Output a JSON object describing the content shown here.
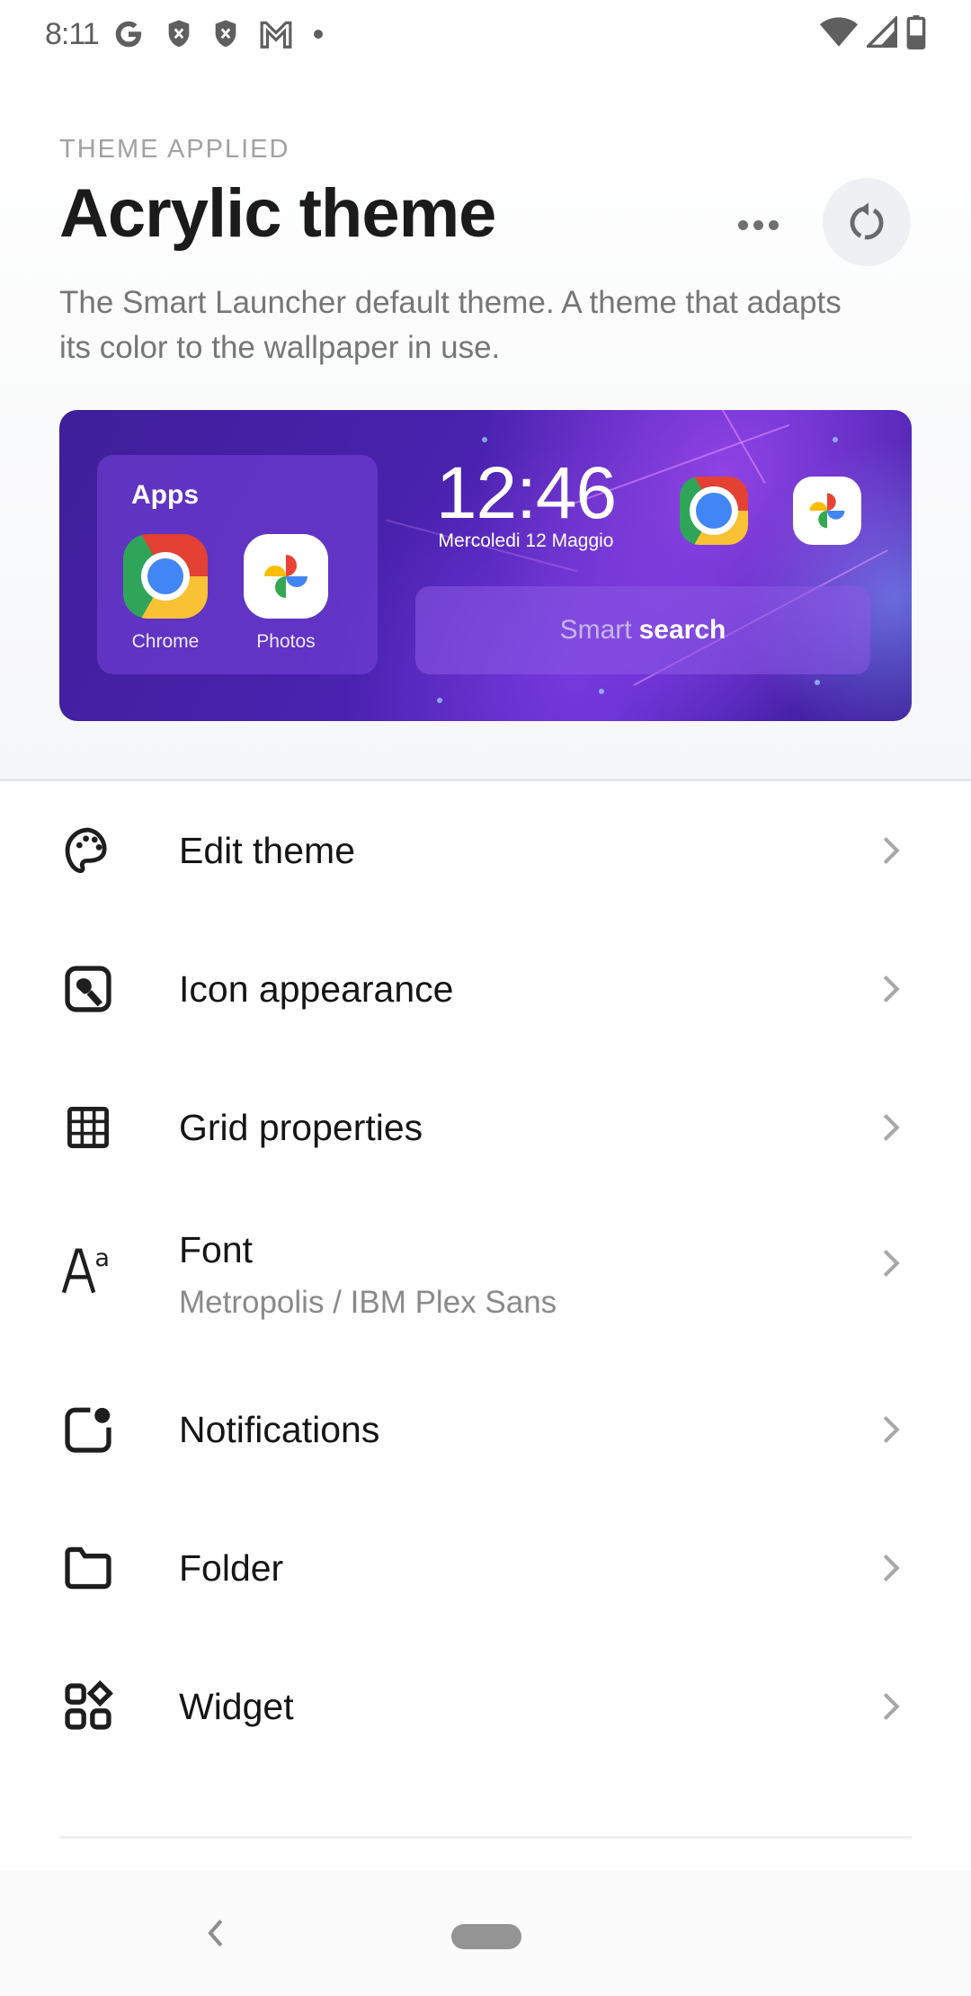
{
  "status_bar": {
    "time": "8:11",
    "left_icons": [
      "google-icon",
      "shield-x-icon",
      "shield-x-icon",
      "gmail-icon",
      "dot-icon"
    ],
    "right_icons": [
      "wifi-icon",
      "cell-signal-icon",
      "battery-icon"
    ]
  },
  "header": {
    "eyebrow": "THEME APPLIED",
    "title": "Acrylic theme",
    "more_icon": "more-horizontal-icon",
    "reset_icon": "reset-icon",
    "description": "The Smart Launcher default theme. A theme that adapts its color to the wallpaper in use."
  },
  "preview": {
    "apps_title": "Apps",
    "apps": [
      {
        "label": "Chrome",
        "icon": "chrome-icon"
      },
      {
        "label": "Photos",
        "icon": "photos-icon"
      }
    ],
    "clock_time": "12:46",
    "clock_date": "Mercoledi 12 Maggio",
    "dock_icons": [
      "chrome-icon",
      "photos-icon"
    ],
    "search_part1": "Smart",
    "search_part2": "search",
    "colors": {
      "background": "#4a22b0",
      "panel": "#6a3ccf"
    }
  },
  "menu": [
    {
      "label": "Edit theme",
      "icon": "palette-icon"
    },
    {
      "label": "Icon appearance",
      "icon": "icon-appearance-icon"
    },
    {
      "label": "Grid properties",
      "icon": "grid-icon"
    },
    {
      "label": "Font",
      "subtitle": "Metropolis / IBM Plex Sans",
      "icon": "font-icon"
    },
    {
      "label": "Notifications",
      "icon": "notification-badge-icon"
    },
    {
      "label": "Folder",
      "icon": "folder-icon"
    },
    {
      "label": "Widget",
      "icon": "widget-icon"
    }
  ],
  "navbar": {
    "back_icon": "nav-back-icon",
    "home_icon": "nav-home-pill"
  }
}
